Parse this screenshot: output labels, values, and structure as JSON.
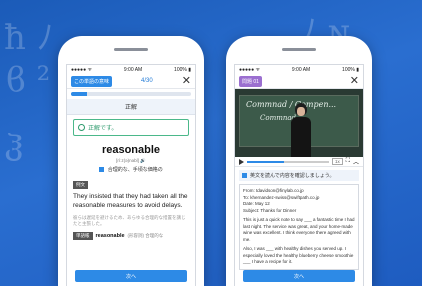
{
  "phone_left": {
    "status": {
      "carrier": "●●●●● ᯤ",
      "time": "9:00 AM",
      "battery": "100% ▮"
    },
    "tag": "この単語の意味",
    "count": "4/30",
    "progress": 0.13,
    "panel_title": "正解",
    "correct_text": "正解です。",
    "word": "reasonable",
    "pronunciation": "[ríːz(ə)nəbl]",
    "meaning": "合理的な、手頃な価格の",
    "example_label": "例文",
    "example_text": "They insisted that they had taken all the reasonable measures to avoid delays.",
    "example_jp": "彼らは遅延を避けるため、あらゆる合理的な措置を講じたと主張した。",
    "vocab_label": "単語帳",
    "vocab_word": "reasonable",
    "vocab_detail": "(形容詞) 合理的な",
    "next_label": "次へ"
  },
  "phone_right": {
    "status": {
      "carrier": "●●●●● ᯤ",
      "time": "9:00 AM",
      "battery": "100% ▮"
    },
    "tag": "問題 01",
    "board_line1": "Commnad / Compen...",
    "board_line2": "Commnad",
    "instruction": "英文を読んで内容を確認しましょう。",
    "email": {
      "from": "From: tdavidson@finylab.co.jp",
      "to": "To: khernandez-swiss@swiftpath.co.jp",
      "date": "Date: May 12",
      "subject": "Subject: Thanks for Dinner",
      "body1": "This is just a quick note to say ___ a fantastic time I had last night. The service was great, and your home-made wine was excellent. I think everyone there agreed with me.",
      "body2": "Also, I was ___ with healthy dishes you served up. I especially loved the healthy blueberry cheese smoothie ___ I have a recipe for it."
    },
    "next_label": "次へ"
  },
  "colors": {
    "accent": "#2d8ae6",
    "background": "#1e5cc0",
    "correct": "#2c9a6c"
  }
}
